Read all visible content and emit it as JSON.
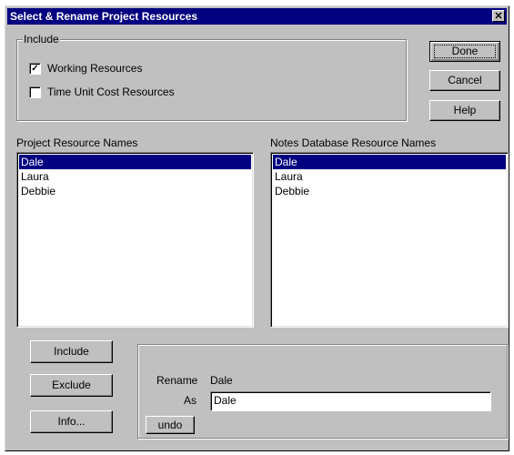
{
  "window": {
    "title": "Select & Rename Project Resources",
    "close_glyph": "✕"
  },
  "include_group": {
    "legend": "Include",
    "options": [
      {
        "label": "Working Resources",
        "checked": true
      },
      {
        "label": "Time Unit Cost Resources",
        "checked": false
      }
    ],
    "check_glyph": "✓"
  },
  "buttons": {
    "done": "Done",
    "cancel": "Cancel",
    "help": "Help",
    "include": "Include",
    "exclude": "Exclude",
    "info": "Info...",
    "undo": "undo"
  },
  "project_list": {
    "label": "Project Resource Names",
    "items": [
      "Dale",
      "Laura",
      "Debbie"
    ],
    "selected": "Dale"
  },
  "notes_list": {
    "label": "Notes Database Resource Names",
    "items": [
      "Dale",
      "Laura",
      "Debbie"
    ],
    "selected": "Dale"
  },
  "rename": {
    "rename_label": "Rename",
    "current_name": "Dale",
    "as_label": "As",
    "new_name": "Dale"
  }
}
